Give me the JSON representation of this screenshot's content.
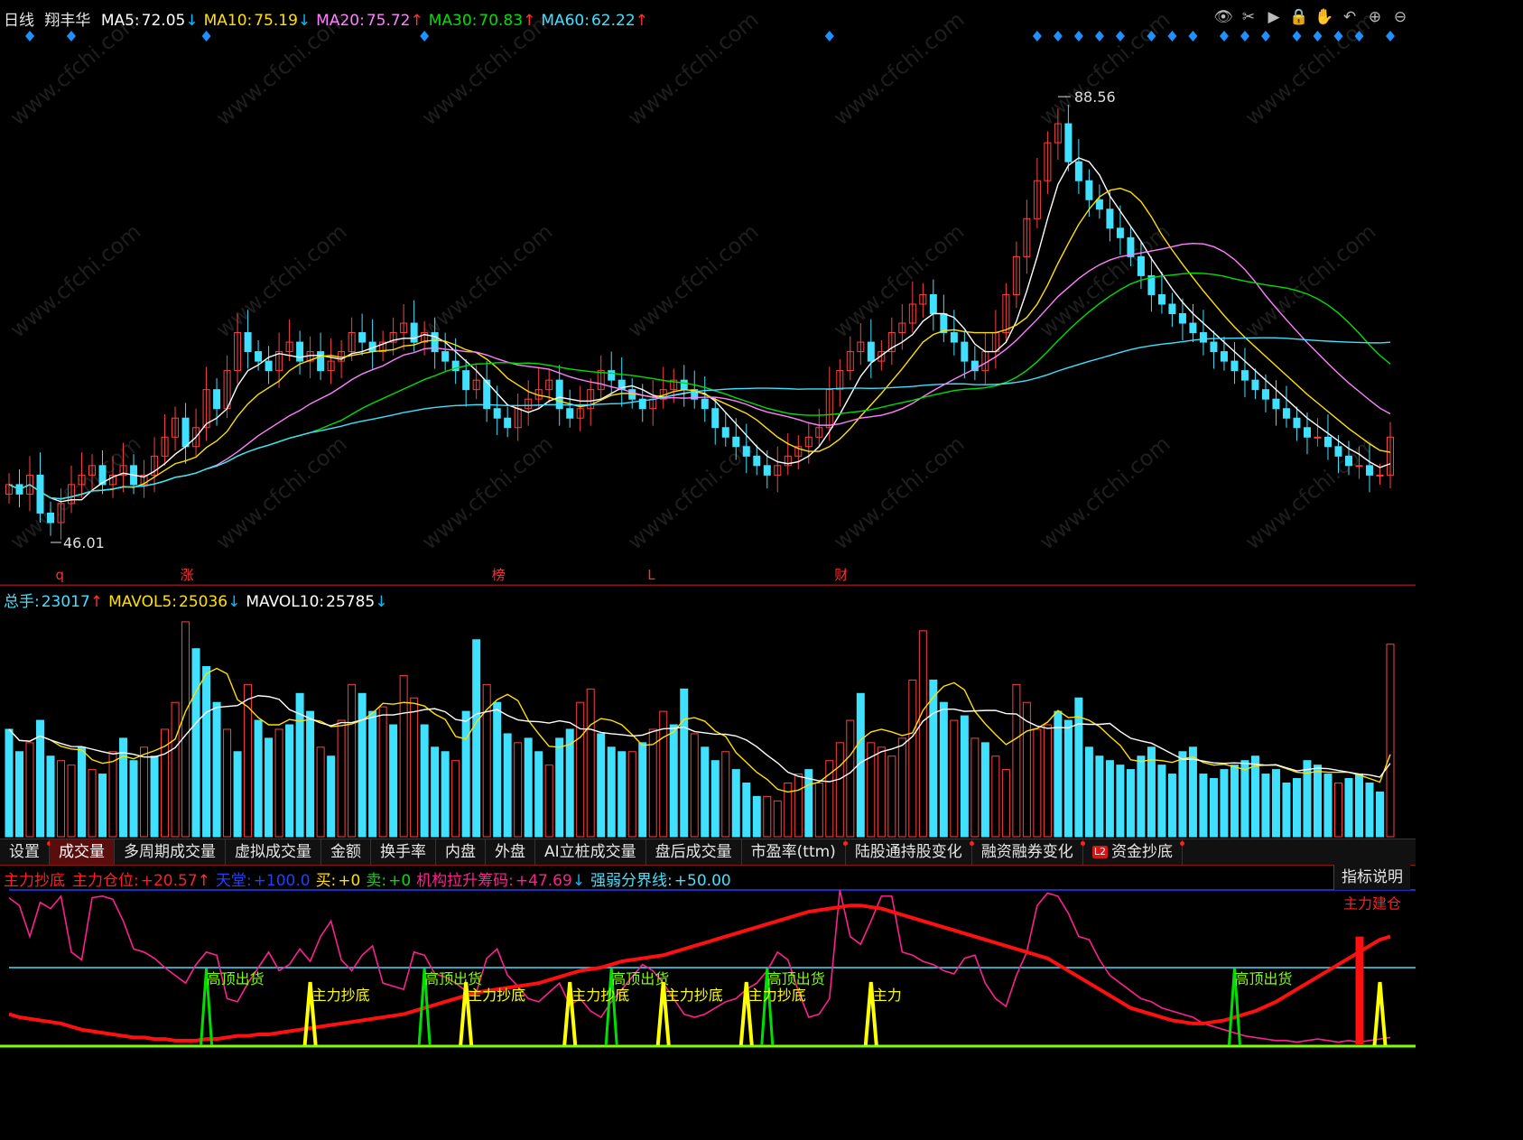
{
  "price": {
    "period": "日线",
    "stock": "翔丰华",
    "ma": [
      {
        "label": "MA5:",
        "value": "72.05",
        "arrow": "↓",
        "color": "#ffffff",
        "arrowColor": "#00bfff"
      },
      {
        "label": "MA10:",
        "value": "75.19",
        "arrow": "↓",
        "color": "#ffe000",
        "arrowColor": "#00bfff"
      },
      {
        "label": "MA20:",
        "value": "75.72",
        "arrow": "↑",
        "color": "#ff80ff",
        "arrowColor": "#ff3030"
      },
      {
        "label": "MA30:",
        "value": "70.83",
        "arrow": "↑",
        "color": "#00e000",
        "arrowColor": "#ff3030"
      },
      {
        "label": "MA60:",
        "value": "62.22",
        "arrow": "↑",
        "color": "#40e0ff",
        "arrowColor": "#ff3030"
      }
    ],
    "high_label": "88.56",
    "low_label": "46.01",
    "event_markers": [
      "q",
      "涨",
      "榜",
      "L",
      "财"
    ],
    "watermark": "www.cfchi.com"
  },
  "volume": {
    "legend": [
      {
        "label": "总手:",
        "value": "23017",
        "arrow": "↑",
        "color": "#40e0ff",
        "arrowColor": "#ff3030"
      },
      {
        "label": "MAVOL5:",
        "value": "25036",
        "arrow": "↓",
        "color": "#ffe000",
        "arrowColor": "#00bfff"
      },
      {
        "label": "MAVOL10:",
        "value": "25785",
        "arrow": "↓",
        "color": "#ffffff",
        "arrowColor": "#00bfff"
      }
    ]
  },
  "tabs": [
    {
      "label": "设置",
      "dot": true
    },
    {
      "label": "成交量",
      "active": true
    },
    {
      "label": "多周期成交量"
    },
    {
      "label": "虚拟成交量"
    },
    {
      "label": "金额"
    },
    {
      "label": "换手率"
    },
    {
      "label": "内盘"
    },
    {
      "label": "外盘"
    },
    {
      "label": "AI立桩成交量"
    },
    {
      "label": "盘后成交量"
    },
    {
      "label": "市盈率(ttm)",
      "dot": true
    },
    {
      "label": "陆股通持股变化",
      "dot": true
    },
    {
      "label": "融资融券变化",
      "dot": true
    },
    {
      "label": "资金抄底",
      "dot": true,
      "badge": "L2"
    }
  ],
  "indicator": {
    "legend": [
      {
        "label": "主力抄底",
        "value": "",
        "color": "#ff2020"
      },
      {
        "label": "主力仓位:",
        "value": "+20.57",
        "arrow": "↑",
        "color": "#ff2020",
        "arrowColor": "#ff3030"
      },
      {
        "label": "天堂:",
        "value": "+100.0",
        "color": "#2040ff"
      },
      {
        "label": "买:",
        "value": "+0",
        "color": "#ffe000"
      },
      {
        "label": "卖:",
        "value": "+0",
        "color": "#00e000"
      },
      {
        "label": "机构拉升筹码:",
        "value": "+47.69",
        "arrow": "↓",
        "color": "#ff2090",
        "arrowColor": "#00bfff"
      },
      {
        "label": "强弱分界线:",
        "value": "+50.00",
        "color": "#40e0ff"
      }
    ],
    "help": "指标说明",
    "top_labels": [
      "高顶出货",
      "高顶出货",
      "高顶出货",
      "高顶出货",
      "高顶出货"
    ],
    "bottom_labels": [
      "主力抄底",
      "主力抄底",
      "主力抄底",
      "主力抄底",
      "主力抄底",
      "主力"
    ],
    "build_label": "主力建仓"
  },
  "chart_data": {
    "type": "line",
    "title": "",
    "price_range": [
      44,
      92
    ],
    "close": [
      50,
      49,
      51,
      47,
      46,
      48,
      50,
      51,
      52,
      50,
      51,
      52,
      50,
      51,
      53,
      55,
      57,
      54,
      56,
      60,
      58,
      62,
      66,
      64,
      63,
      62,
      64,
      65,
      63,
      64,
      62,
      63,
      64,
      66,
      65,
      64,
      65,
      66,
      67,
      65,
      66,
      64,
      63,
      62,
      60,
      61,
      58,
      57,
      56,
      58,
      59,
      60,
      61,
      58,
      57,
      58,
      60,
      62,
      61,
      60,
      59,
      58,
      59,
      60,
      61,
      60,
      59,
      58,
      56,
      55,
      54,
      53,
      52,
      51,
      52,
      53,
      54,
      55,
      56,
      60,
      62,
      64,
      65,
      63,
      64,
      66,
      67,
      69,
      70,
      68,
      66,
      65,
      63,
      62,
      64,
      66,
      70,
      74,
      78,
      82,
      86,
      88,
      84,
      82,
      80,
      79,
      77,
      76,
      74,
      72,
      70,
      69,
      68,
      67,
      66,
      65,
      64,
      63,
      62,
      61,
      60,
      59,
      58,
      57,
      56,
      55,
      55,
      54,
      53,
      52,
      52,
      51,
      51,
      55
    ],
    "ma_colors": [
      "#ffffff",
      "#ffe000",
      "#ff80ff",
      "#00e000",
      "#40e0ff"
    ],
    "ma_periods": [
      5,
      10,
      20,
      30,
      60
    ],
    "volume": [
      120,
      95,
      105,
      130,
      90,
      85,
      80,
      100,
      75,
      70,
      95,
      110,
      85,
      100,
      90,
      120,
      150,
      240,
      210,
      190,
      150,
      120,
      95,
      170,
      130,
      110,
      120,
      125,
      160,
      140,
      100,
      90,
      130,
      170,
      160,
      140,
      145,
      125,
      180,
      155,
      125,
      100,
      95,
      85,
      140,
      220,
      170,
      150,
      115,
      105,
      110,
      95,
      80,
      110,
      120,
      150,
      165,
      115,
      100,
      95,
      95,
      105,
      120,
      140,
      125,
      165,
      115,
      100,
      85,
      95,
      75,
      60,
      45,
      45,
      40,
      60,
      70,
      75,
      60,
      85,
      105,
      130,
      160,
      105,
      100,
      90,
      110,
      175,
      230,
      175,
      150,
      130,
      135,
      110,
      105,
      90,
      75,
      170,
      150,
      120,
      125,
      140,
      130,
      155,
      100,
      90,
      85,
      80,
      75,
      90,
      100,
      80,
      70,
      95,
      100,
      70,
      65,
      75,
      80,
      85,
      90,
      70,
      75,
      60,
      65,
      85,
      80,
      70,
      60,
      65,
      70,
      60,
      50,
      215
    ],
    "vol_max": 250,
    "vol_up": [
      false,
      false,
      true,
      false,
      false,
      true,
      true,
      false,
      true,
      false,
      true,
      false,
      false,
      true,
      false,
      true,
      true,
      true,
      false,
      false,
      false,
      true,
      false,
      true,
      false,
      false,
      true,
      false,
      false,
      false,
      true,
      false,
      true,
      true,
      false,
      false,
      true,
      false,
      true,
      true,
      false,
      false,
      false,
      true,
      false,
      false,
      true,
      false,
      false,
      true,
      false,
      false,
      true,
      false,
      false,
      true,
      true,
      false,
      false,
      false,
      true,
      false,
      true,
      true,
      false,
      false,
      true,
      false,
      false,
      true,
      false,
      false,
      false,
      true,
      true,
      true,
      true,
      false,
      true,
      true,
      true,
      true,
      false,
      true,
      true,
      true,
      true,
      true,
      true,
      false,
      false,
      true,
      false,
      true,
      false,
      true,
      true,
      true,
      true,
      true,
      true,
      false,
      false,
      false,
      false,
      false,
      false,
      false,
      false,
      false,
      false,
      false,
      false,
      false,
      false,
      false,
      false,
      false,
      false,
      false,
      false,
      false,
      false,
      false,
      false,
      false,
      false,
      false,
      true,
      false,
      false,
      false,
      false,
      true
    ],
    "ind_position": [
      20,
      18,
      17,
      16,
      15,
      14,
      12,
      10,
      9,
      8,
      7,
      6,
      5,
      5,
      4,
      4,
      3,
      3,
      3,
      4,
      4,
      5,
      6,
      6,
      7,
      7,
      8,
      9,
      10,
      11,
      12,
      13,
      14,
      15,
      16,
      17,
      18,
      19,
      20,
      22,
      24,
      26,
      28,
      30,
      32,
      34,
      35,
      36,
      37,
      38,
      39,
      40,
      42,
      44,
      46,
      48,
      49,
      50,
      52,
      54,
      55,
      56,
      57,
      58,
      60,
      62,
      64,
      66,
      68,
      70,
      72,
      74,
      76,
      78,
      80,
      82,
      84,
      86,
      87,
      88,
      89,
      90,
      90,
      89,
      88,
      86,
      84,
      82,
      80,
      78,
      76,
      74,
      72,
      70,
      68,
      66,
      64,
      62,
      60,
      58,
      56,
      52,
      48,
      44,
      40,
      36,
      32,
      28,
      24,
      22,
      20,
      18,
      16,
      15,
      14,
      14,
      15,
      16,
      18,
      20,
      22,
      25,
      28,
      32,
      36,
      40,
      44,
      48,
      52,
      56,
      60,
      64,
      68,
      70
    ],
    "ind_mark": [
      95,
      90,
      70,
      92,
      88,
      96,
      60,
      55,
      95,
      96,
      94,
      80,
      62,
      60,
      56,
      50,
      45,
      40,
      52,
      60,
      58,
      30,
      28,
      40,
      50,
      60,
      48,
      52,
      62,
      54,
      70,
      80,
      55,
      48,
      58,
      64,
      40,
      38,
      36,
      60,
      58,
      46,
      44,
      40,
      35,
      34,
      56,
      62,
      45,
      38,
      30,
      28,
      34,
      40,
      26,
      30,
      22,
      18,
      28,
      36,
      44,
      52,
      48,
      40,
      30,
      20,
      18,
      20,
      24,
      28,
      30,
      36,
      40,
      48,
      60,
      55,
      35,
      18,
      20,
      30,
      100,
      70,
      65,
      80,
      96,
      96,
      60,
      58,
      54,
      52,
      48,
      46,
      56,
      58,
      40,
      30,
      25,
      45,
      60,
      90,
      98,
      96,
      85,
      70,
      68,
      55,
      45,
      40,
      35,
      30,
      28,
      24,
      22,
      20,
      18,
      14,
      12,
      10,
      8,
      6,
      5,
      4,
      3,
      3,
      2,
      3,
      4,
      3,
      2,
      3,
      2,
      3,
      4,
      5
    ],
    "ind_top_peaks": [
      19,
      40,
      58,
      73,
      118
    ],
    "ind_bottom_peaks": [
      29,
      44,
      54,
      63,
      71,
      83,
      132
    ]
  }
}
